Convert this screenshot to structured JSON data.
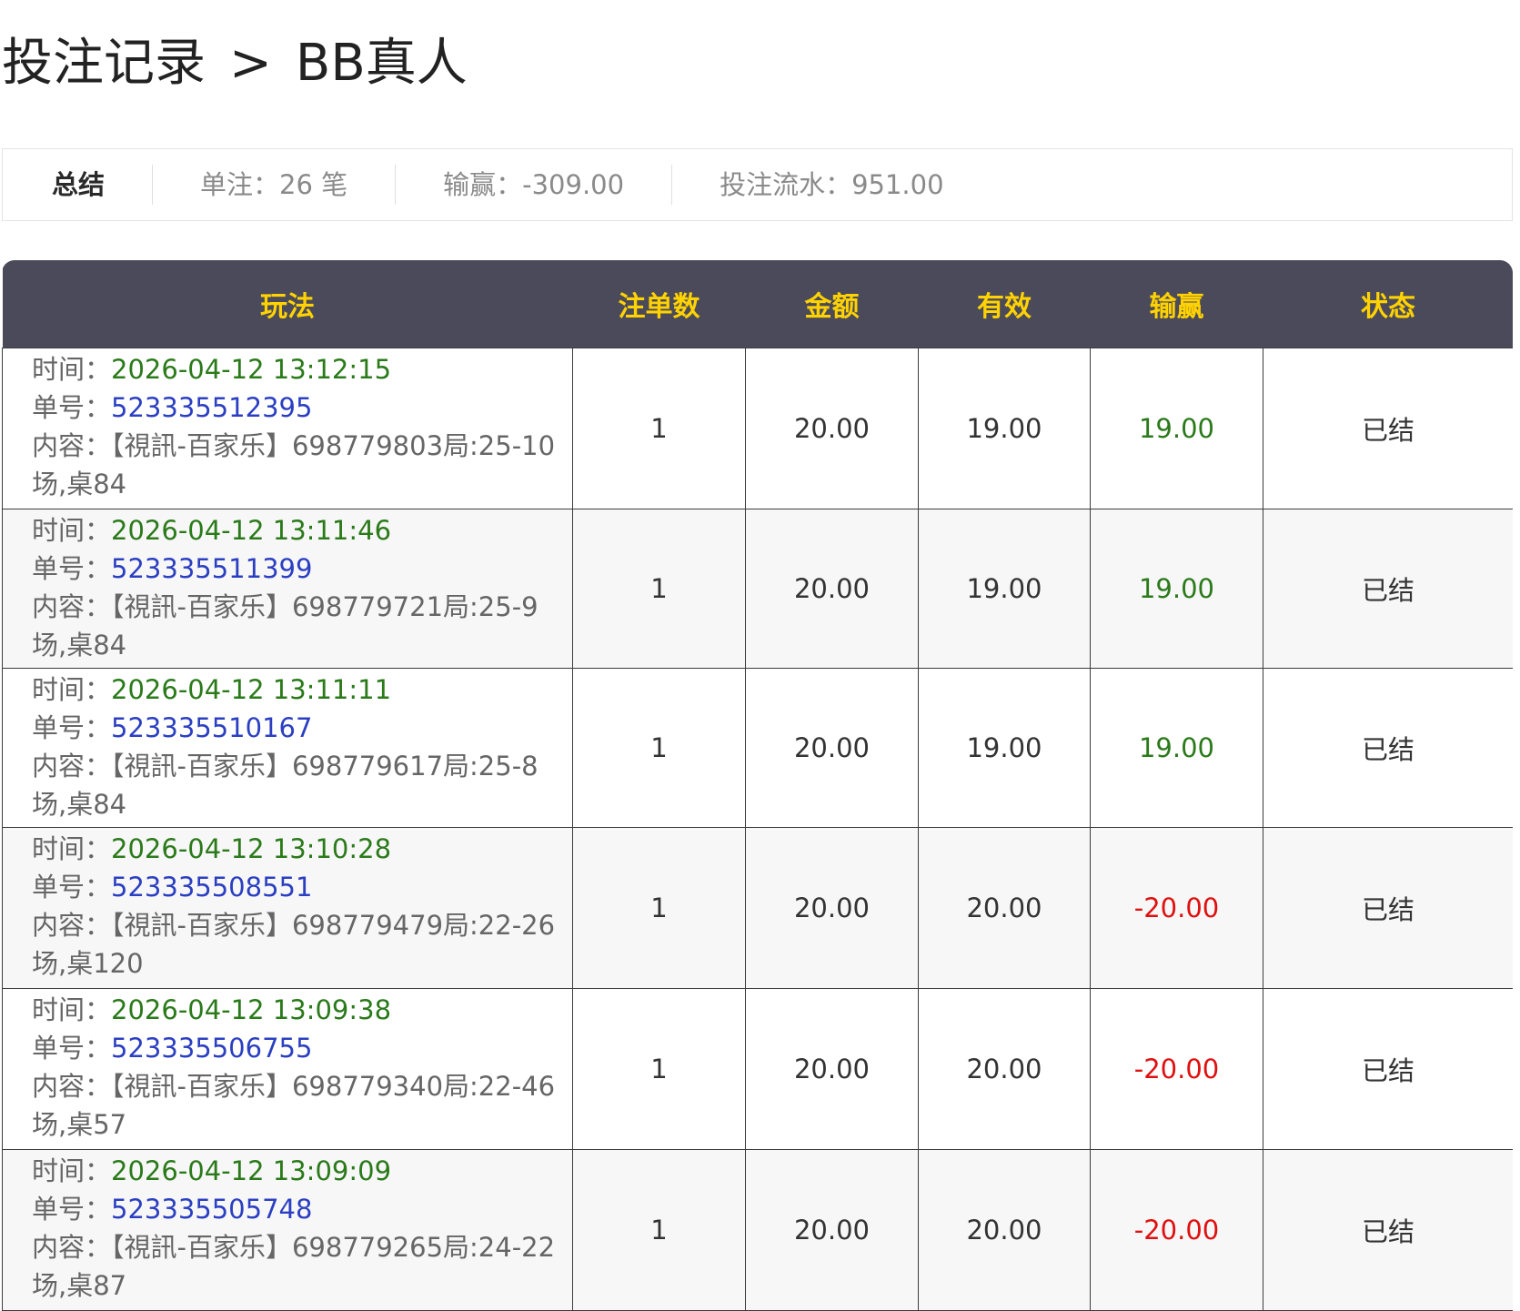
{
  "breadcrumb": {
    "parent": "投注记录",
    "separator": ">",
    "current": "BB真人"
  },
  "summary": {
    "label": "总结",
    "bets": "单注：26 笔",
    "profit": "输赢：-309.00",
    "turnover": "投注流水：951.00"
  },
  "table": {
    "headers": {
      "game": "玩法",
      "count": "注单数",
      "amount": "金额",
      "valid": "有效",
      "winloss": "输赢",
      "status": "状态"
    },
    "labels": {
      "time": "时间：",
      "order": "单号：",
      "content": "内容："
    },
    "rows": [
      {
        "time": "2026-04-12 13:12:15",
        "order": "523335512395",
        "content": "【視訊-百家乐】698779803局:25-10场,桌84",
        "count": "1",
        "amount": "20.00",
        "valid": "19.00",
        "winloss": "19.00",
        "status": "已结"
      },
      {
        "time": "2026-04-12 13:11:46",
        "order": "523335511399",
        "content": "【視訊-百家乐】698779721局:25-9场,桌84",
        "count": "1",
        "amount": "20.00",
        "valid": "19.00",
        "winloss": "19.00",
        "status": "已结"
      },
      {
        "time": "2026-04-12 13:11:11",
        "order": "523335510167",
        "content": "【視訊-百家乐】698779617局:25-8场,桌84",
        "count": "1",
        "amount": "20.00",
        "valid": "19.00",
        "winloss": "19.00",
        "status": "已结"
      },
      {
        "time": "2026-04-12 13:10:28",
        "order": "523335508551",
        "content": "【視訊-百家乐】698779479局:22-26场,桌120",
        "count": "1",
        "amount": "20.00",
        "valid": "20.00",
        "winloss": "-20.00",
        "status": "已结"
      },
      {
        "time": "2026-04-12 13:09:38",
        "order": "523335506755",
        "content": "【視訊-百家乐】698779340局:22-46场,桌57",
        "count": "1",
        "amount": "20.00",
        "valid": "20.00",
        "winloss": "-20.00",
        "status": "已结"
      },
      {
        "time": "2026-04-12 13:09:09",
        "order": "523335505748",
        "content": "【視訊-百家乐】698779265局:24-22场,桌87",
        "count": "1",
        "amount": "20.00",
        "valid": "20.00",
        "winloss": "-20.00",
        "status": "已结"
      }
    ]
  },
  "colors": {
    "header_bg": "#4a4a5a",
    "header_text": "#ffd200",
    "win": "#2a7a1a",
    "lose": "#e01010",
    "order": "#2b3fc2"
  }
}
